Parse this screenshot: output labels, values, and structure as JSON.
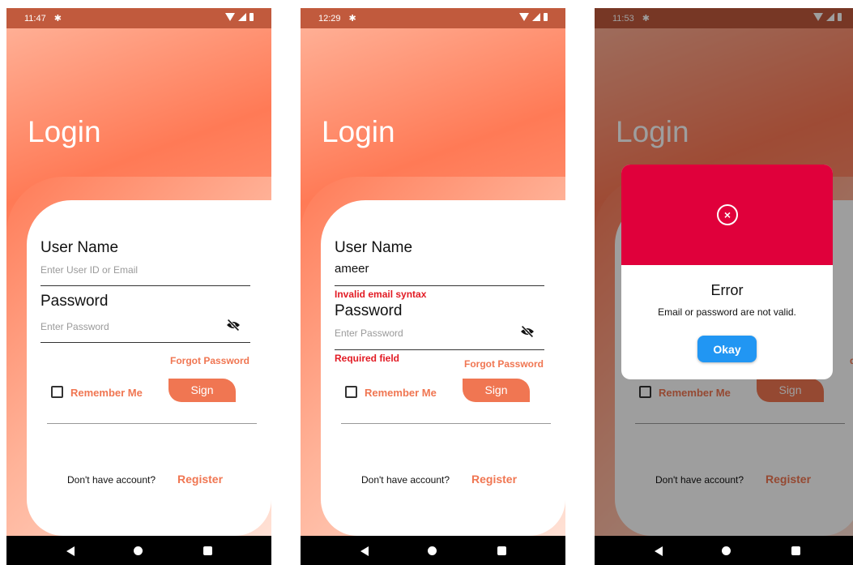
{
  "colors": {
    "accent": "#f07652",
    "error": "#e21b24",
    "dialog_header": "#e0003b",
    "okay_button": "#2196f3"
  },
  "screens": [
    {
      "status": {
        "time": "11:47"
      },
      "title": "Login",
      "username_label": "User Name",
      "username_placeholder": "Enter User ID or Email",
      "password_label": "Password",
      "password_placeholder": "Enter Password",
      "forgot": "Forgot Password",
      "remember": "Remember Me",
      "sign": "Sign",
      "no_account": "Don't have account?",
      "register": "Register"
    },
    {
      "status": {
        "time": "12:29"
      },
      "title": "Login",
      "username_label": "User Name",
      "username_value": "ameer",
      "username_error": "Invalid email syntax",
      "password_label": "Password",
      "password_placeholder": "Enter Password",
      "password_error": "Required field",
      "forgot": "Forgot Password",
      "remember": "Remember Me",
      "sign": "Sign",
      "no_account": "Don't have account?",
      "register": "Register"
    },
    {
      "status": {
        "time": "11:53"
      },
      "title": "Login",
      "forgot_fragment": "d",
      "remember": "Remember Me",
      "sign": "Sign",
      "no_account": "Don't have account?",
      "register": "Register",
      "dialog": {
        "title": "Error",
        "message": "Email or password are not valid.",
        "button": "Okay"
      }
    }
  ]
}
